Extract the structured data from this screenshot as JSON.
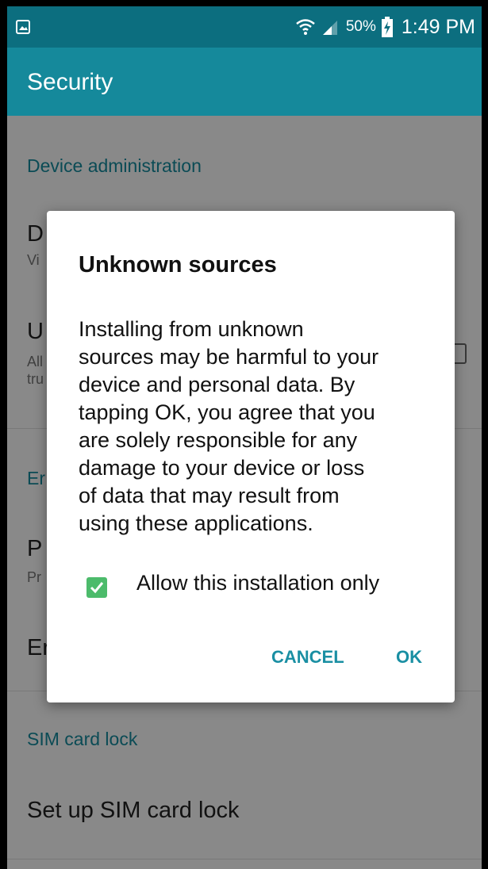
{
  "status_bar": {
    "battery_percent": "50%",
    "time": "1:49 PM",
    "icons": [
      "gallery-icon",
      "wifi-icon",
      "signal-icon",
      "battery-charging-icon"
    ]
  },
  "app_bar": {
    "title": "Security"
  },
  "background": {
    "section_device_admin": "Device administration",
    "row1_title": "D",
    "row1_sub": "Vi",
    "row2_title": "U",
    "row2_sub_line1": "All",
    "row2_sub_line2": "tru",
    "section_encryption": "Er",
    "row3_title": "P",
    "row3_sub": "Pr",
    "row4_title": "Er",
    "section_sim": "SIM card lock",
    "row_sim": "Set up SIM card lock"
  },
  "dialog": {
    "title": "Unknown sources",
    "body_lines": [
      "Installing from unknown",
      "sources may be harmful to your",
      "device and personal data. By",
      "tapping OK, you agree that you",
      "are solely responsible for any",
      "damage to your device or loss",
      "of data that may result from",
      "using these applications."
    ],
    "checkbox_label": "Allow this installation only",
    "checkbox_checked": true,
    "cancel_label": "CANCEL",
    "ok_label": "OK"
  },
  "colors": {
    "status_bar": "#0c6e7f",
    "app_bar": "#15899b",
    "accent": "#1a8fa3",
    "checkbox": "#4cbb6b"
  }
}
